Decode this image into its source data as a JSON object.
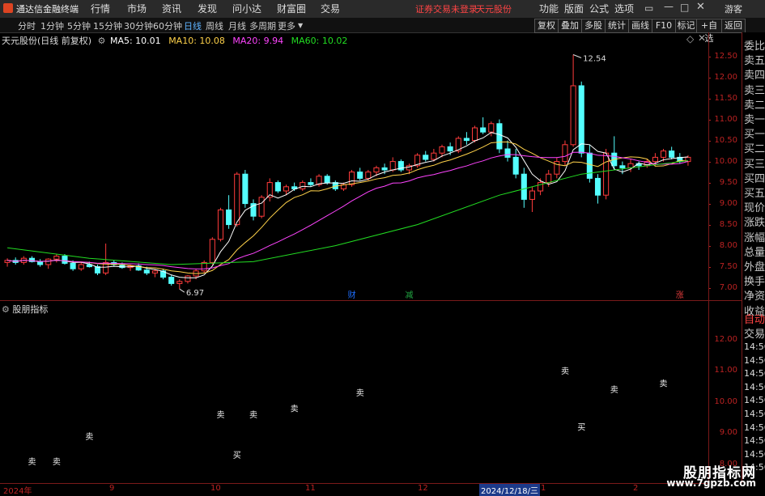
{
  "app": {
    "logo_text": "通达信金融终端",
    "menus": [
      "行情",
      "市场",
      "资讯",
      "发现",
      "问小达",
      "财富圈",
      "交易"
    ],
    "notice": "证券交易未登录",
    "stock_title": "天元股份",
    "right_menus": [
      "功能",
      "版面",
      "公式",
      "选项"
    ],
    "guest": "游客"
  },
  "periods": [
    "分时",
    "1分钟",
    "5分钟",
    "15分钟",
    "30分钟",
    "60分钟",
    "日线",
    "周线",
    "月线",
    "多周期",
    "更多"
  ],
  "active_period": "日线",
  "toolbar": [
    "复权",
    "叠加",
    "多股",
    "统计",
    "画线",
    "F10",
    "标记",
    "+自选",
    "返回"
  ],
  "chart_header": {
    "title": "天元股份(日线 前复权)",
    "ma5": "MA5: 10.01",
    "ma10": "MA10: 10.08",
    "ma20": "MA20: 9.94",
    "ma60": "MA60: 10.02"
  },
  "annotations": {
    "high_label": "12.54",
    "low_label": "6.97",
    "tags": [
      "财",
      "减",
      "涨"
    ]
  },
  "indicator": {
    "title": "股朋指标",
    "sell": "卖",
    "buy": "买"
  },
  "right_panel": [
    "委比",
    "卖五",
    "卖四",
    "卖三",
    "卖二",
    "卖一",
    "买一",
    "买二",
    "买三",
    "买四",
    "买五",
    "现价",
    "涨跌",
    "涨幅",
    "总量",
    "外盘",
    "换手",
    "净资",
    "收益",
    "自动",
    "交易",
    "14:56",
    "14:56",
    "14:56",
    "14:56",
    "14:56",
    "14:56",
    "14:56",
    "14:56",
    "14:56",
    "14:56"
  ],
  "x_axis": [
    "2024年",
    "9",
    "10",
    "11",
    "12",
    "2024/12/18/三",
    "1",
    "2"
  ],
  "watermark": {
    "line1": "股朋指标网",
    "line2": "www.7gpzb.com"
  },
  "colors": {
    "up": "#ff3b3b",
    "down": "#54ffff",
    "ma5": "#ffffff",
    "ma10": "#ffd24a",
    "ma20": "#ff44ff",
    "ma60": "#22dd22",
    "axis": "#b22222"
  },
  "chart_data": [
    {
      "type": "candlestick",
      "title": "天元股份(日线 前复权)",
      "y_ticks": [
        12.5,
        12.0,
        11.5,
        11.0,
        10.5,
        10.0,
        9.5,
        9.0,
        8.5,
        8.0,
        7.5,
        7.0
      ],
      "ylim": [
        6.8,
        12.8
      ],
      "x_ticks": [
        "2024年",
        "9",
        "10",
        "11",
        "12",
        "2024/12/18/三",
        "1",
        "2"
      ],
      "candles": [
        [
          7.6,
          7.7,
          7.5,
          7.65
        ],
        [
          7.65,
          7.72,
          7.55,
          7.6
        ],
        [
          7.6,
          7.75,
          7.55,
          7.7
        ],
        [
          7.7,
          7.75,
          7.6,
          7.62
        ],
        [
          7.62,
          7.68,
          7.5,
          7.55
        ],
        [
          7.55,
          7.7,
          7.45,
          7.68
        ],
        [
          7.68,
          7.8,
          7.6,
          7.75
        ],
        [
          7.75,
          7.8,
          7.55,
          7.58
        ],
        [
          7.58,
          7.65,
          7.4,
          7.45
        ],
        [
          7.45,
          7.6,
          7.4,
          7.55
        ],
        [
          7.55,
          7.62,
          7.48,
          7.5
        ],
        [
          7.5,
          7.55,
          7.3,
          7.35
        ],
        [
          7.35,
          8.05,
          7.3,
          7.6
        ],
        [
          7.6,
          7.65,
          7.5,
          7.55
        ],
        [
          7.55,
          7.6,
          7.45,
          7.48
        ],
        [
          7.48,
          7.55,
          7.4,
          7.52
        ],
        [
          7.52,
          7.58,
          7.4,
          7.42
        ],
        [
          7.42,
          7.5,
          7.3,
          7.35
        ],
        [
          7.35,
          7.45,
          7.25,
          7.4
        ],
        [
          7.4,
          7.45,
          7.2,
          7.25
        ],
        [
          7.25,
          7.3,
          7.05,
          7.1
        ],
        [
          7.1,
          7.2,
          6.97,
          7.15
        ],
        [
          7.15,
          7.3,
          7.1,
          7.28
        ],
        [
          7.28,
          7.45,
          7.2,
          7.4
        ],
        [
          7.4,
          7.65,
          7.35,
          7.6
        ],
        [
          7.6,
          8.2,
          7.55,
          8.15
        ],
        [
          8.15,
          8.9,
          8.1,
          8.85
        ],
        [
          8.85,
          9.2,
          8.4,
          8.5
        ],
        [
          8.5,
          9.75,
          8.45,
          9.7
        ],
        [
          9.7,
          9.8,
          8.9,
          9.0
        ],
        [
          9.0,
          9.1,
          8.6,
          8.7
        ],
        [
          8.7,
          9.2,
          8.65,
          9.15
        ],
        [
          9.15,
          9.6,
          9.05,
          9.5
        ],
        [
          9.5,
          9.55,
          9.25,
          9.3
        ],
        [
          9.3,
          9.45,
          9.2,
          9.4
        ],
        [
          9.4,
          9.5,
          9.3,
          9.35
        ],
        [
          9.35,
          9.55,
          9.3,
          9.5
        ],
        [
          9.5,
          9.6,
          9.4,
          9.45
        ],
        [
          9.45,
          9.7,
          9.4,
          9.65
        ],
        [
          9.65,
          9.7,
          9.45,
          9.5
        ],
        [
          9.5,
          9.55,
          9.3,
          9.35
        ],
        [
          9.35,
          9.5,
          9.3,
          9.45
        ],
        [
          9.45,
          9.8,
          9.4,
          9.75
        ],
        [
          9.75,
          9.85,
          9.55,
          9.6
        ],
        [
          9.6,
          9.8,
          9.55,
          9.75
        ],
        [
          9.75,
          9.9,
          9.65,
          9.85
        ],
        [
          9.85,
          9.95,
          9.7,
          9.8
        ],
        [
          9.8,
          10.1,
          9.75,
          10.0
        ],
        [
          10.0,
          10.05,
          9.75,
          9.8
        ],
        [
          9.8,
          9.95,
          9.7,
          9.9
        ],
        [
          9.9,
          10.2,
          9.85,
          10.15
        ],
        [
          10.15,
          10.25,
          10.0,
          10.05
        ],
        [
          10.05,
          10.3,
          10.0,
          10.2
        ],
        [
          10.2,
          10.4,
          10.1,
          10.35
        ],
        [
          10.35,
          10.45,
          10.15,
          10.25
        ],
        [
          10.25,
          10.6,
          10.2,
          10.55
        ],
        [
          10.55,
          10.7,
          10.4,
          10.5
        ],
        [
          10.5,
          10.85,
          10.45,
          10.8
        ],
        [
          10.8,
          11.05,
          10.65,
          10.7
        ],
        [
          10.7,
          10.95,
          10.6,
          10.9
        ],
        [
          10.9,
          11.0,
          10.2,
          10.3
        ],
        [
          10.3,
          10.5,
          10.0,
          10.1
        ],
        [
          10.1,
          10.3,
          9.6,
          9.7
        ],
        [
          9.7,
          9.85,
          8.9,
          9.1
        ],
        [
          9.1,
          9.4,
          8.8,
          9.3
        ],
        [
          9.3,
          9.6,
          9.2,
          9.5
        ],
        [
          9.5,
          9.8,
          9.4,
          9.7
        ],
        [
          9.7,
          10.1,
          9.6,
          10.0
        ],
        [
          10.0,
          10.5,
          9.9,
          10.4
        ],
        [
          10.4,
          12.54,
          10.35,
          11.8
        ],
        [
          11.8,
          11.9,
          10.1,
          10.2
        ],
        [
          10.2,
          10.4,
          9.5,
          9.6
        ],
        [
          9.6,
          9.7,
          9.0,
          9.2
        ],
        [
          9.2,
          10.3,
          9.1,
          10.2
        ],
        [
          10.2,
          10.6,
          9.8,
          9.9
        ],
        [
          9.9,
          10.0,
          9.7,
          9.85
        ],
        [
          9.85,
          10.05,
          9.75,
          9.95
        ],
        [
          9.95,
          10.0,
          9.8,
          9.9
        ],
        [
          9.9,
          10.05,
          9.85,
          10.0
        ],
        [
          10.0,
          10.2,
          9.9,
          10.1
        ],
        [
          10.1,
          10.3,
          10.0,
          10.25
        ],
        [
          10.25,
          10.35,
          10.05,
          10.1
        ],
        [
          10.1,
          10.2,
          9.95,
          10.0
        ],
        [
          10.0,
          10.15,
          9.9,
          10.1
        ]
      ],
      "ma60_points": [
        [
          0,
          7.95
        ],
        [
          10,
          7.7
        ],
        [
          20,
          7.55
        ],
        [
          30,
          7.62
        ],
        [
          40,
          8.0
        ],
        [
          50,
          8.5
        ],
        [
          60,
          9.2
        ],
        [
          70,
          9.7
        ],
        [
          83,
          10.02
        ]
      ]
    },
    {
      "type": "scatter",
      "title": "股朋指标",
      "y_ticks": [
        12.0,
        11.0,
        10.0,
        9.0,
        8.0
      ],
      "ylim": [
        7.5,
        12.8
      ],
      "signals": [
        {
          "label": "卖",
          "x": 3,
          "y": 8.0
        },
        {
          "label": "卖",
          "x": 6,
          "y": 8.0
        },
        {
          "label": "卖",
          "x": 10,
          "y": 8.8
        },
        {
          "label": "卖",
          "x": 26,
          "y": 9.5
        },
        {
          "label": "买",
          "x": 28,
          "y": 8.2
        },
        {
          "label": "卖",
          "x": 30,
          "y": 9.5
        },
        {
          "label": "卖",
          "x": 35,
          "y": 9.7
        },
        {
          "label": "卖",
          "x": 43,
          "y": 10.2
        },
        {
          "label": "卖",
          "x": 68,
          "y": 10.9
        },
        {
          "label": "买",
          "x": 70,
          "y": 9.1
        },
        {
          "label": "卖",
          "x": 74,
          "y": 10.3
        },
        {
          "label": "卖",
          "x": 80,
          "y": 10.5
        }
      ]
    }
  ]
}
